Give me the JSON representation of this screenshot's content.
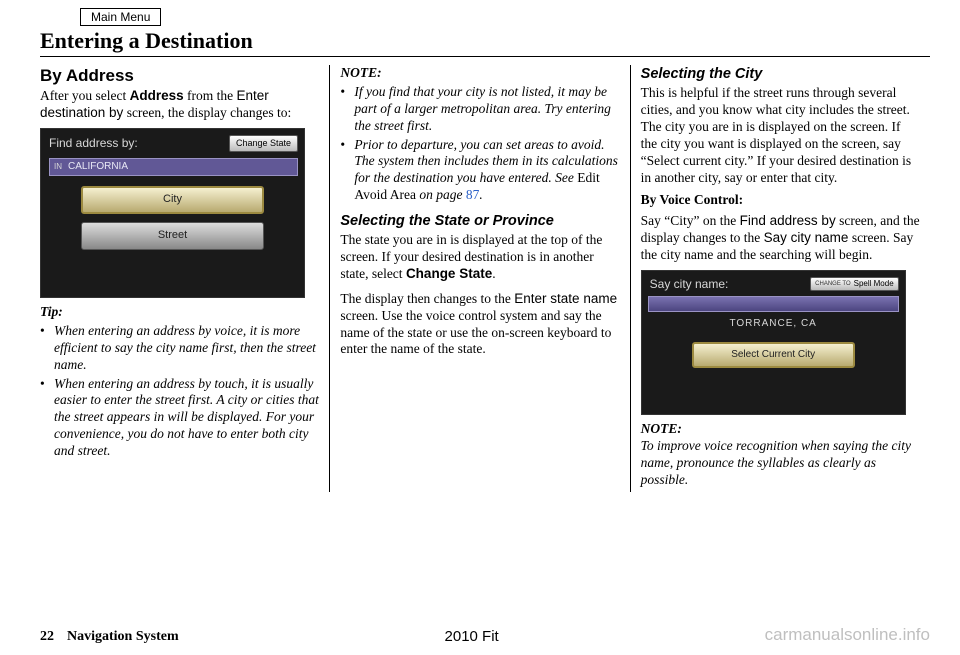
{
  "header": {
    "main_menu": "Main Menu",
    "title": "Entering a Destination"
  },
  "col1": {
    "section": "By Address",
    "intro_1": "After you select ",
    "intro_bold": "Address",
    "intro_2": " from the ",
    "intro_ui": "Enter destination by",
    "intro_3": " screen, the display changes to:",
    "shot": {
      "title": "Find address by:",
      "change_state": "Change State",
      "in": "IN",
      "state": "CALIFORNIA",
      "city_btn": "City",
      "street_btn": "Street"
    },
    "tip_label": "Tip:",
    "tips": [
      "When entering an address by voice, it is more efficient to say the city name first, then the street name.",
      "When entering an address by touch, it is usually easier to enter the street first. A city or cities that the street appears in will be displayed. For your convenience, you do not have to enter both city and street."
    ]
  },
  "col2": {
    "note_label": "NOTE:",
    "notes": {
      "n1": "If you find that your city is not listed, it may be part of a larger metropolitan area. Try entering the street first.",
      "n2a": "Prior to departure, you can set areas to avoid. The system then includes them in its calculations for the destination you have entered. See ",
      "n2b": "Edit Avoid Area",
      "n2c": " on page ",
      "n2d": "87",
      "n2e": "."
    },
    "sub1": "Selecting the State or Province",
    "p1a": "The state you are in is displayed at the top of the screen. If your desired destination is in another state, select ",
    "p1b": "Change State",
    "p1c": ".",
    "p2a": "The display then changes to the ",
    "p2b": "Enter state name",
    "p2c": " screen. Use the voice control system and say the name of the state or use the on-screen keyboard to enter the name of the state."
  },
  "col3": {
    "sub1": "Selecting the City",
    "p1": "This is helpful if the street runs through several cities, and you know what city includes the street. The city you are in is displayed on the screen. If the city you want is displayed on the screen, say “Select current city.” If your desired destination is in another city, say or enter that city.",
    "voice_label": "By Voice Control:",
    "p2a": "Say “City” on the ",
    "p2b": "Find address by",
    "p2c": " screen, and the display changes to the ",
    "p2d": "Say city name",
    "p2e": " screen. Say the city name and the searching will begin.",
    "shot": {
      "title": "Say city name:",
      "change_lbl": "CHANGE TO",
      "change_btn": "Spell Mode",
      "city": "TORRANCE, CA",
      "select_btn": "Select Current City"
    },
    "note_label": "NOTE:",
    "note_text": "To improve voice recognition when saying the city name, pronounce the syllables as clearly as possible."
  },
  "footer": {
    "page_no": "22",
    "section": "Navigation System",
    "model": "2010 Fit",
    "watermark": "carmanualsonline.info"
  }
}
